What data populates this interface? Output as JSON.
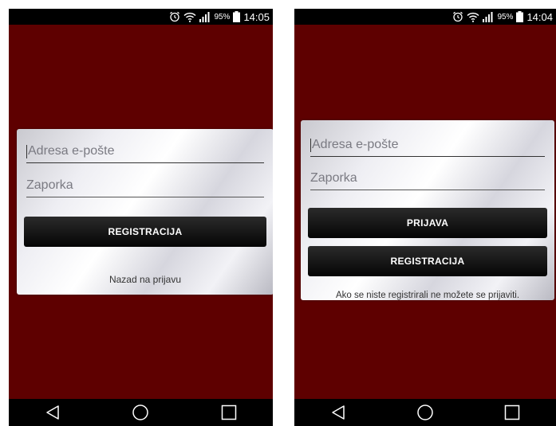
{
  "status_bar": {
    "left_phone": {
      "battery": "95%",
      "time": "14:05"
    },
    "right_phone": {
      "battery": "95%",
      "time": "14:04"
    },
    "icons": [
      "alarm-icon",
      "wifi-icon",
      "signal-icon",
      "battery-icon"
    ]
  },
  "register_screen": {
    "email_placeholder": "Adresa e-pošte",
    "password_placeholder": "Zaporka",
    "register_button": "REGISTRACIJA",
    "back_link": "Nazad na prijavu"
  },
  "login_screen": {
    "email_placeholder": "Adresa e-pošte",
    "password_placeholder": "Zaporka",
    "login_button": "PRIJAVA",
    "register_button": "REGISTRACIJA",
    "info_text": "Ako se niste registrirali ne možete se prijaviti."
  },
  "nav_bar": {
    "icons": [
      "back-icon",
      "home-icon",
      "recents-icon"
    ]
  },
  "colors": {
    "background": "#5e0000",
    "button": "#111111",
    "card_gradient": "silver"
  }
}
